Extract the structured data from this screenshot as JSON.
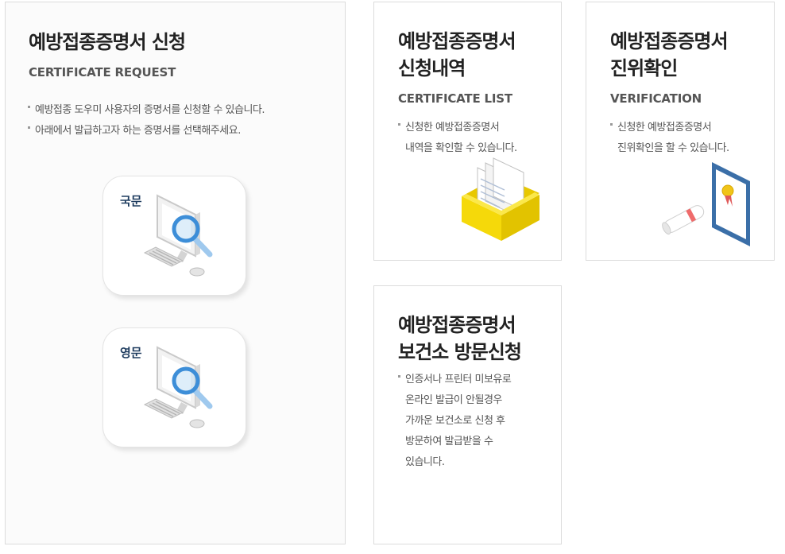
{
  "request": {
    "title": "예방접종증명서 신청",
    "subtitle": "CERTIFICATE REQUEST",
    "bullets": [
      "예방접종 도우미 사용자의 증명서를 신청할 수 있습니다.",
      "아래에서 발급하고자 하는 증명서를 선택해주세요."
    ],
    "options": [
      {
        "label": "국문"
      },
      {
        "label": "영문"
      }
    ]
  },
  "list": {
    "title_line1": "예방접종증명서",
    "title_line2": "신청내역",
    "subtitle": "CERTIFICATE LIST",
    "bullet_line1": "신청한 예방접종증명서",
    "bullet_line2": "내역을 확인할 수 있습니다."
  },
  "verification": {
    "title_line1": "예방접종증명서",
    "title_line2": "진위확인",
    "subtitle": "VERIFICATION",
    "bullet_line1": "신청한 예방접종증명서",
    "bullet_line2": "진위확인을 할 수 있습니다."
  },
  "visit": {
    "title_line1": "예방접종증명서",
    "title_line2": "보건소 방문신청",
    "bullet_lines": [
      "인증서나 프린터 미보유로",
      "온라인 발급이 안될경우",
      "가까운 보건소로 신청 후",
      "방문하여 발급받을 수",
      "있습니다."
    ]
  },
  "colors": {
    "title": "#222222",
    "text": "#555555",
    "label": "#1d3b5e",
    "border": "#dcdcdc",
    "magnifier": "#3d8ed8",
    "folder": "#f5d90a",
    "frame": "#3b6fa8"
  }
}
